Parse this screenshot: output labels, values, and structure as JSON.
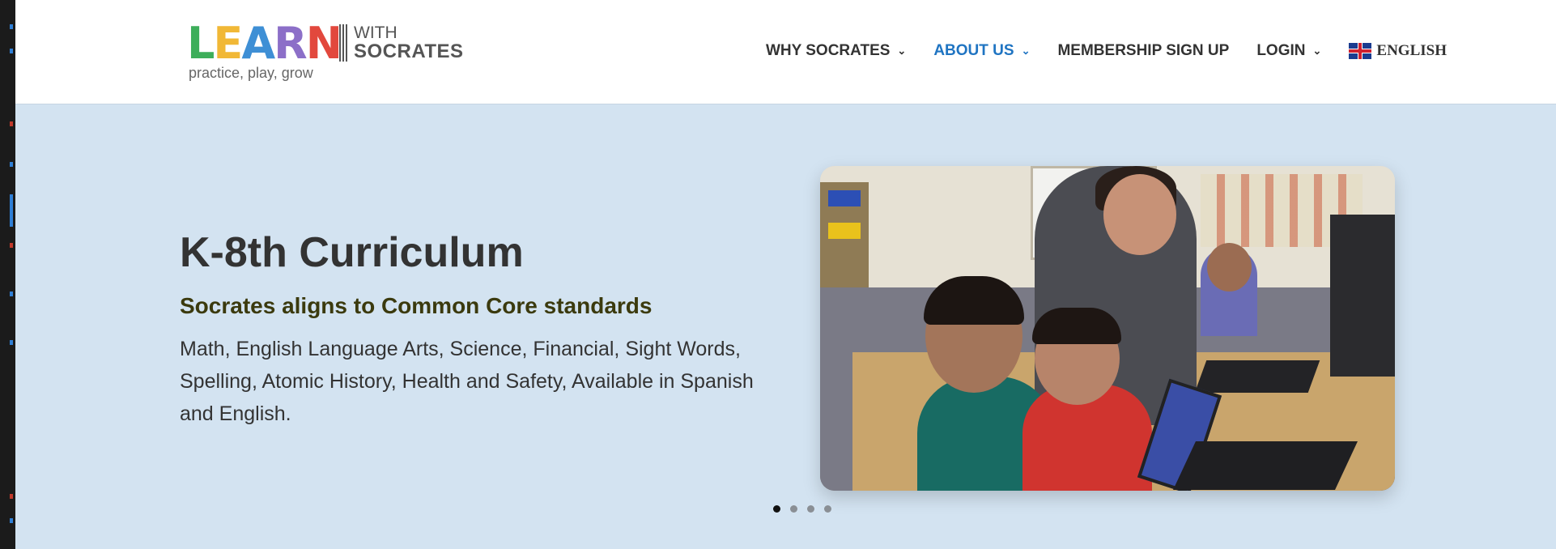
{
  "brand": {
    "logo_letters": [
      "L",
      "E",
      "A",
      "R",
      "N"
    ],
    "logo_with": "WITH",
    "logo_socrates": "SOCRATES",
    "tagline": "practice, play, grow"
  },
  "nav": {
    "items": [
      {
        "label": "WHY SOCRATES",
        "has_dropdown": true,
        "active": false
      },
      {
        "label": "ABOUT US",
        "has_dropdown": true,
        "active": true
      },
      {
        "label": "MEMBERSHIP SIGN UP",
        "has_dropdown": false,
        "active": false
      },
      {
        "label": "LOGIN",
        "has_dropdown": true,
        "active": false
      }
    ],
    "language": {
      "label": "ENGLISH",
      "icon": "uk-flag-icon"
    },
    "dropdown_icon": "chevron-down-icon"
  },
  "hero": {
    "title": "K-8th Curriculum",
    "subtitle": "Socrates aligns to Common Core standards",
    "description": "Math, English Language Arts, Science, Financial, Sight Words, Spelling, Atomic History, Health and Safety, Available in Spanish and English.",
    "slides_count": 4,
    "active_slide": 1
  },
  "colors": {
    "hero_background": "#d3e3f1",
    "nav_active": "#1f74c2",
    "subtitle": "#3b3a0e",
    "text": "#333333"
  }
}
